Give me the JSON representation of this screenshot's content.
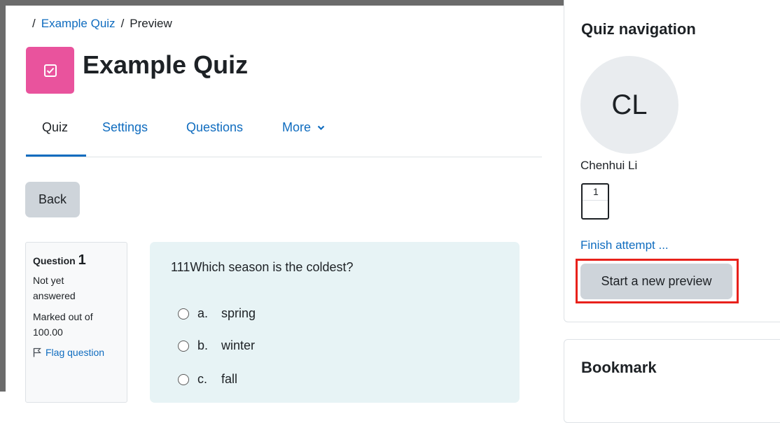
{
  "breadcrumb": {
    "separator": "/",
    "items": [
      {
        "label": "Example Quiz"
      },
      {
        "label": "Preview"
      }
    ]
  },
  "page": {
    "title": "Example Quiz",
    "icon": "quiz-checkbox-icon",
    "icon_color": "#e9539d"
  },
  "tabs": [
    {
      "label": "Quiz",
      "active": true
    },
    {
      "label": "Settings",
      "active": false
    },
    {
      "label": "Questions",
      "active": false
    },
    {
      "label": "More",
      "active": false
    }
  ],
  "back_button": {
    "label": "Back"
  },
  "question_info": {
    "label": "Question",
    "number": "1",
    "status_line1": "Not yet",
    "status_line2": "answered",
    "marks_line1": "Marked out of",
    "marks_line2": "100.00",
    "flag_label": "Flag question"
  },
  "question": {
    "text": "111Which season is the coldest?",
    "options": [
      {
        "letter": "a.",
        "label": "spring"
      },
      {
        "letter": "b.",
        "label": "winter"
      },
      {
        "letter": "c.",
        "label": "fall"
      }
    ]
  },
  "quiz_navigation": {
    "title": "Quiz navigation",
    "avatar_initials": "CL",
    "user_name": "Chenhui Li",
    "question_buttons": [
      {
        "label": "1"
      }
    ],
    "finish_attempt": "Finish attempt ...",
    "start_new_preview": "Start a new preview"
  },
  "bookmark": {
    "title": "Bookmark"
  },
  "colors": {
    "accent": "#0f6cbf",
    "highlight_box": "#e8211b",
    "button_bg": "#ced4da"
  }
}
